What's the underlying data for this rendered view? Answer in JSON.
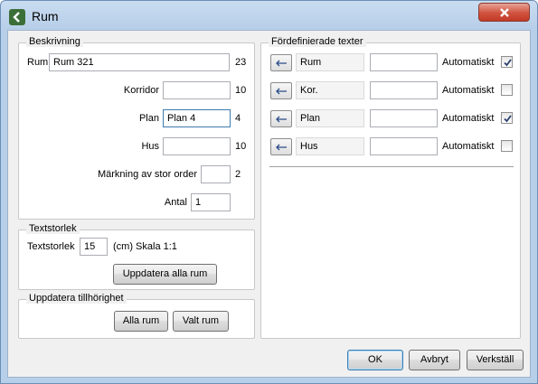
{
  "window": {
    "title": "Rum"
  },
  "beskrivning": {
    "title": "Beskrivning",
    "rows": [
      {
        "label": "Rum",
        "value": "Rum 321",
        "count": "23"
      },
      {
        "label": "Korridor",
        "value": "",
        "count": "10"
      },
      {
        "label": "Plan",
        "value": "Plan 4",
        "count": "4"
      },
      {
        "label": "Hus",
        "value": "",
        "count": "10"
      },
      {
        "label": "Märkning av stor order",
        "value": "",
        "count": "2"
      },
      {
        "label": "Antal",
        "value": "1"
      }
    ]
  },
  "textstorlek": {
    "title": "Textstorlek",
    "label": "Textstorlek",
    "value": "15",
    "unit_text": "(cm) Skala 1:1",
    "update_button": "Uppdatera alla rum"
  },
  "tillhorighet": {
    "title": "Uppdatera tillhörighet",
    "all_button": "Alla rum",
    "selected_button": "Valt rum"
  },
  "fordefinierade": {
    "title": "Fördefinierade texter",
    "rows": [
      {
        "arrow": "←",
        "name": "Rum",
        "value": "",
        "auto_label": "Automatiskt",
        "checked": true
      },
      {
        "arrow": "←",
        "name": "Kor.",
        "value": "",
        "auto_label": "Automatiskt",
        "checked": false
      },
      {
        "arrow": "←",
        "name": "Plan",
        "value": "",
        "auto_label": "Automatiskt",
        "checked": true
      },
      {
        "arrow": "←",
        "name": "Hus",
        "value": "",
        "auto_label": "Automatiskt",
        "checked": false
      }
    ]
  },
  "footer": {
    "ok": "OK",
    "cancel": "Avbryt",
    "apply": "Verkställ"
  }
}
